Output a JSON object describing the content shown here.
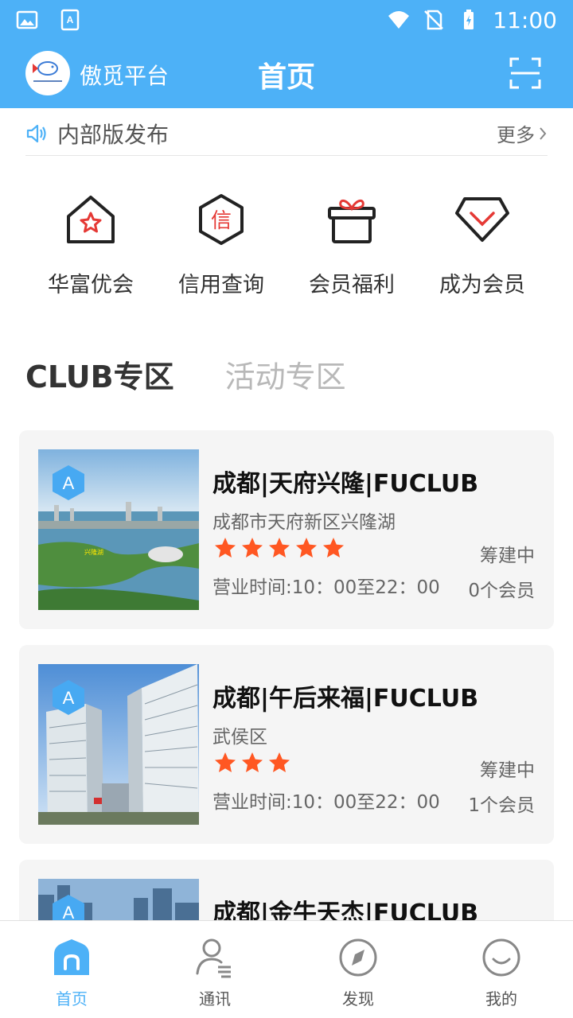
{
  "status_bar": {
    "time": "11:00"
  },
  "header": {
    "brand": "傲觅平台",
    "title": "首页"
  },
  "notice": {
    "text": "内部版发布",
    "more": "更多"
  },
  "quick_actions": [
    {
      "label": "华富优会",
      "icon": "home-star-icon"
    },
    {
      "label": "信用查询",
      "icon": "credit-hexagon-icon"
    },
    {
      "label": "会员福利",
      "icon": "gift-icon"
    },
    {
      "label": "成为会员",
      "icon": "diamond-icon"
    }
  ],
  "tabs": [
    {
      "label": "CLUB专区",
      "active": true
    },
    {
      "label": "活动专区",
      "active": false
    }
  ],
  "clubs": [
    {
      "badge": "A",
      "name": "成都|天府兴隆|FUCLUB",
      "address": "成都市天府新区兴隆湖",
      "rating": 5,
      "hours": "营业时间:10：00至22：00",
      "status": "筹建中",
      "members": "0个会员",
      "image_caption": "兴隆湖"
    },
    {
      "badge": "A",
      "name": "成都|午后来福|FUCLUB",
      "address": "武侯区",
      "rating": 3,
      "hours": "营业时间:10：00至22：00",
      "status": "筹建中",
      "members": "1个会员"
    },
    {
      "badge": "A",
      "name": "成都|金牛天杰|FUCLUB"
    }
  ],
  "bottom_nav": [
    {
      "label": "首页",
      "icon": "home-icon",
      "active": true
    },
    {
      "label": "通讯",
      "icon": "contacts-icon",
      "active": false
    },
    {
      "label": "发现",
      "icon": "compass-icon",
      "active": false
    },
    {
      "label": "我的",
      "icon": "smile-icon",
      "active": false
    }
  ],
  "colors": {
    "primary": "#4db1f7",
    "star": "#ff5722",
    "accent_red": "#e53935"
  }
}
